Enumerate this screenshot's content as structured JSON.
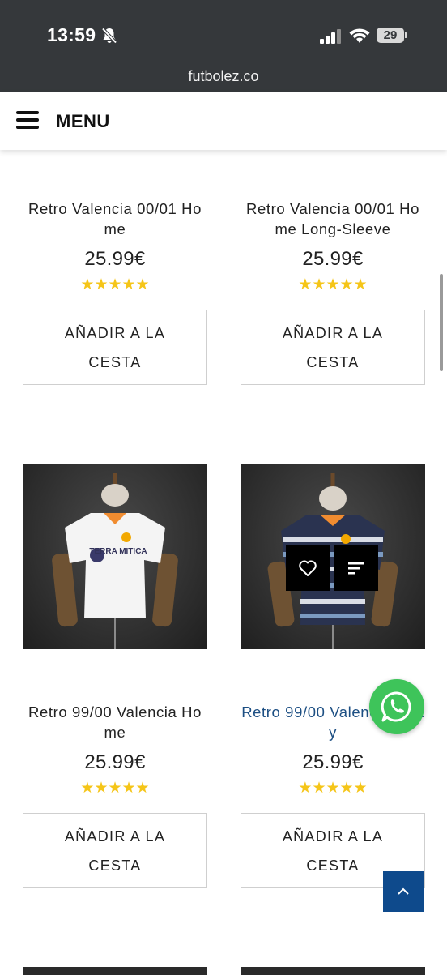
{
  "status_bar": {
    "time": "13:59",
    "battery": "29"
  },
  "browser": {
    "url": "futbolez.co"
  },
  "header": {
    "menu_label": "MENU"
  },
  "products": [
    {
      "title": "Retro Valencia 00/01 Home",
      "price": "25.99€",
      "stars": "★★★★★",
      "cart_label_1": "AÑADIR A LA",
      "cart_label_2": "CESTA"
    },
    {
      "title": "Retro Valencia 00/01 Home Long-Sleeve",
      "price": "25.99€",
      "stars": "★★★★★",
      "cart_label_1": "AÑADIR A LA",
      "cart_label_2": "CESTA"
    },
    {
      "title": "Retro 99/00 Valencia Home",
      "price": "25.99€",
      "stars": "★★★★★",
      "cart_label_1": "AÑADIR A LA",
      "cart_label_2": "CESTA",
      "shirt_text": "TERRA MITICA"
    },
    {
      "title": "Retro 99/00 Valencia Away",
      "price": "25.99€",
      "stars": "★★★★★",
      "cart_label_1": "AÑADIR A LA",
      "cart_label_2": "CESTA"
    }
  ],
  "colors": {
    "topbar": "#35383b",
    "stars": "#f5c518",
    "whatsapp": "#3ec45a",
    "back_to_top": "#0e4a8c",
    "link_hover": "#1d4f83"
  },
  "icons": {
    "wishlist": "heart-icon",
    "quickview": "list-icon",
    "whatsapp": "whatsapp-icon",
    "back_to_top": "chevron-up-icon"
  }
}
